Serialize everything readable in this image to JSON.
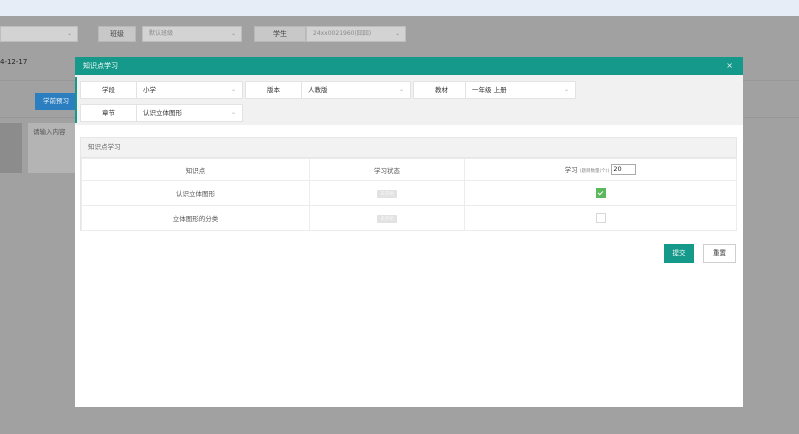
{
  "background": {
    "filters": {
      "left_select_value": "",
      "class_label": "班级",
      "class_placeholder": "默认班级",
      "student_label": "学生",
      "student_value": "24xx0021960(囧囧)"
    },
    "date": "4-12-17",
    "preview_button": "学前预习",
    "input_placeholder": "请输入内容"
  },
  "modal": {
    "title": "知识点学习",
    "close_icon": "×",
    "filters": {
      "stage_label": "学段",
      "stage_value": "小学",
      "edition_label": "版本",
      "edition_value": "人教版",
      "textbook_label": "教材",
      "textbook_value": "一年级 上册",
      "chapter_label": "章节",
      "chapter_value": "认识立体图形"
    },
    "panel": {
      "title": "知识点学习",
      "columns": {
        "knowledge_point": "知识点",
        "status": "学习状态",
        "study": "学习",
        "study_sub": "(题目数量(个))",
        "study_count": "20"
      },
      "rows": [
        {
          "name": "认识立体图形",
          "status": "未开始",
          "checked": true
        },
        {
          "name": "立体图形的分类",
          "status": "未开始",
          "checked": false
        }
      ]
    },
    "buttons": {
      "submit": "提交",
      "reset": "重置"
    }
  },
  "colors": {
    "accent": "#14998a",
    "blue_button": "#2b7ebf",
    "check_green": "#5cb85c"
  }
}
